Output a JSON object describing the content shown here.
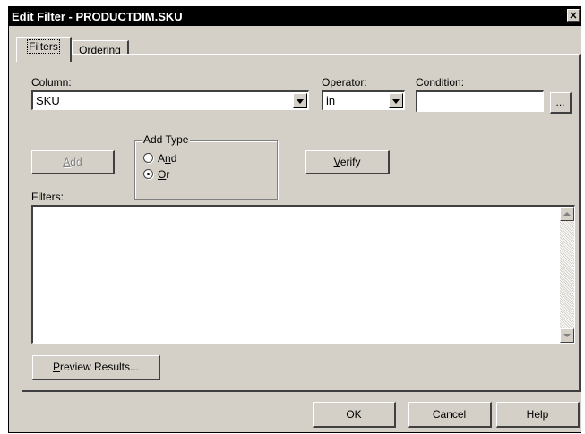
{
  "window": {
    "title": "Edit Filter - PRODUCTDIM.SKU",
    "close_glyph": "✕"
  },
  "tabs": [
    {
      "label": "Filters",
      "active": true
    },
    {
      "label": "Ordering",
      "mnemonic": "O",
      "active": false
    }
  ],
  "column": {
    "label": "Column:",
    "value": "SKU"
  },
  "operator": {
    "label": "Operator:",
    "value": "in"
  },
  "condition": {
    "label": "Condition:",
    "value": "",
    "browse_label": "..."
  },
  "add_button": {
    "label": "Add",
    "mnemonic": "A",
    "enabled": false
  },
  "add_type": {
    "label": "Add Type",
    "options": [
      {
        "label": "And",
        "mnemonic": "n",
        "selected": false
      },
      {
        "label": "Or",
        "mnemonic": "O",
        "selected": true
      }
    ]
  },
  "verify_button": {
    "label": "Verify",
    "mnemonic": "V"
  },
  "filters": {
    "label": "Filters:",
    "items": []
  },
  "preview_button": {
    "label": "Preview Results...",
    "mnemonic": "P"
  },
  "footer": {
    "ok_label": "OK",
    "cancel_label": "Cancel",
    "help_label": "Help"
  },
  "icons": {
    "dropdown": "triangle-down",
    "scroll_up": "triangle-up",
    "scroll_down": "triangle-down"
  }
}
